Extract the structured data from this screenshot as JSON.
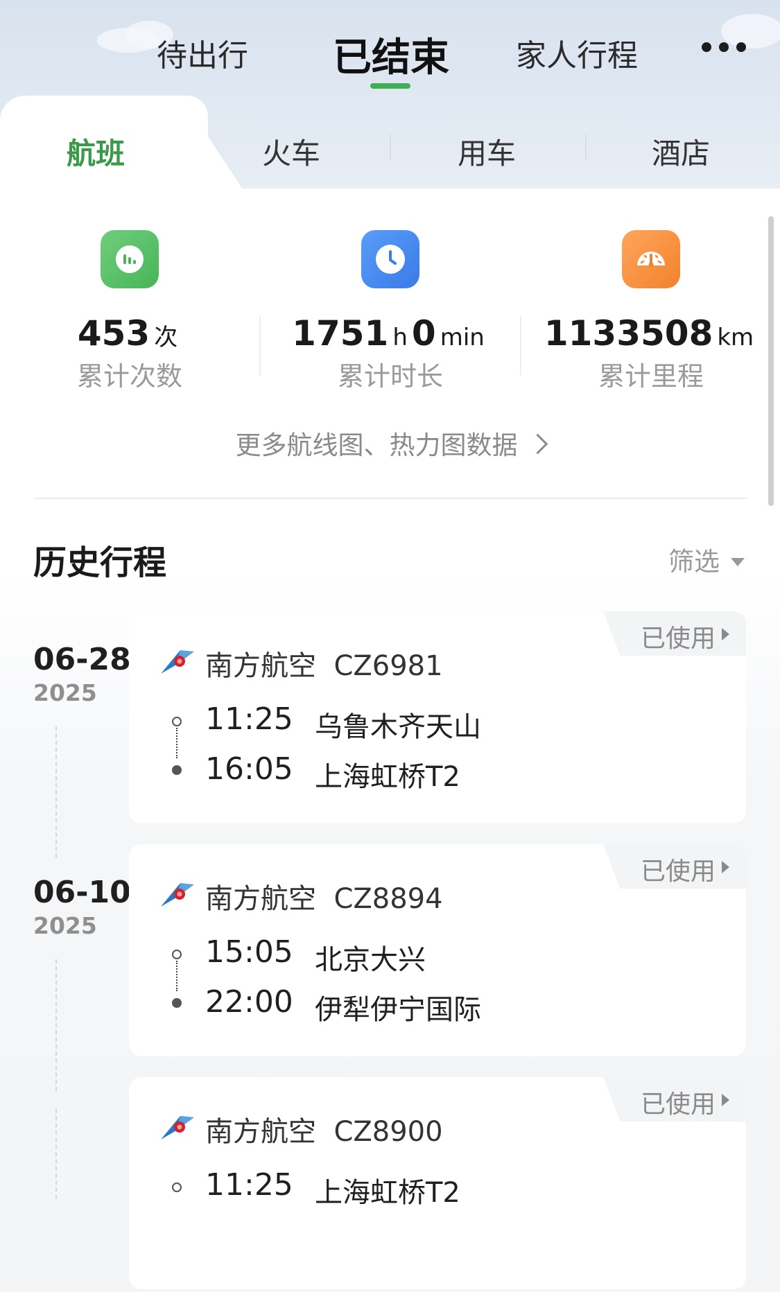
{
  "top_tabs": {
    "upcoming": "待出行",
    "finished": "已结束",
    "family": "家人行程"
  },
  "category_tabs": {
    "flight": "航班",
    "train": "火车",
    "car": "用车",
    "hotel": "酒店"
  },
  "stats": [
    {
      "value": "453",
      "unit": "次",
      "label": "累计次数",
      "icon": "bar-chart-icon"
    },
    {
      "hours": "1751",
      "hours_unit": "h",
      "minutes": "0",
      "minutes_unit": "min",
      "label": "累计时长",
      "icon": "clock-icon"
    },
    {
      "value": "1133508",
      "unit": "km",
      "label": "累计里程",
      "icon": "speedometer-icon"
    }
  ],
  "more_link": "更多航线图、热力图数据",
  "history": {
    "title": "历史行程",
    "filter": "筛选"
  },
  "trips": [
    {
      "date": "06-28",
      "year": "2025",
      "airline": "南方航空",
      "flight": "CZ6981",
      "status": "已使用",
      "dep_time": "11:25",
      "dep_station": "乌鲁木齐天山",
      "arr_time": "16:05",
      "arr_station": "上海虹桥T2"
    },
    {
      "date": "06-10",
      "year": "2025",
      "airline": "南方航空",
      "flight": "CZ8894",
      "status": "已使用",
      "dep_time": "15:05",
      "dep_station": "北京大兴",
      "arr_time": "22:00",
      "arr_station": "伊犁伊宁国际"
    },
    {
      "date": "",
      "year": "",
      "airline": "南方航空",
      "flight": "CZ8900",
      "status": "已使用",
      "dep_time": "11:25",
      "dep_station": "上海虹桥T2",
      "arr_time": "",
      "arr_station": ""
    }
  ],
  "colors": {
    "accent_green": "#3fae54",
    "flight_tab_green": "#3a9a4a",
    "stat_blue": "#3a7be8",
    "stat_orange": "#f2822c",
    "brand_blue": "#2a79c9",
    "brand_red": "#d2232a"
  }
}
